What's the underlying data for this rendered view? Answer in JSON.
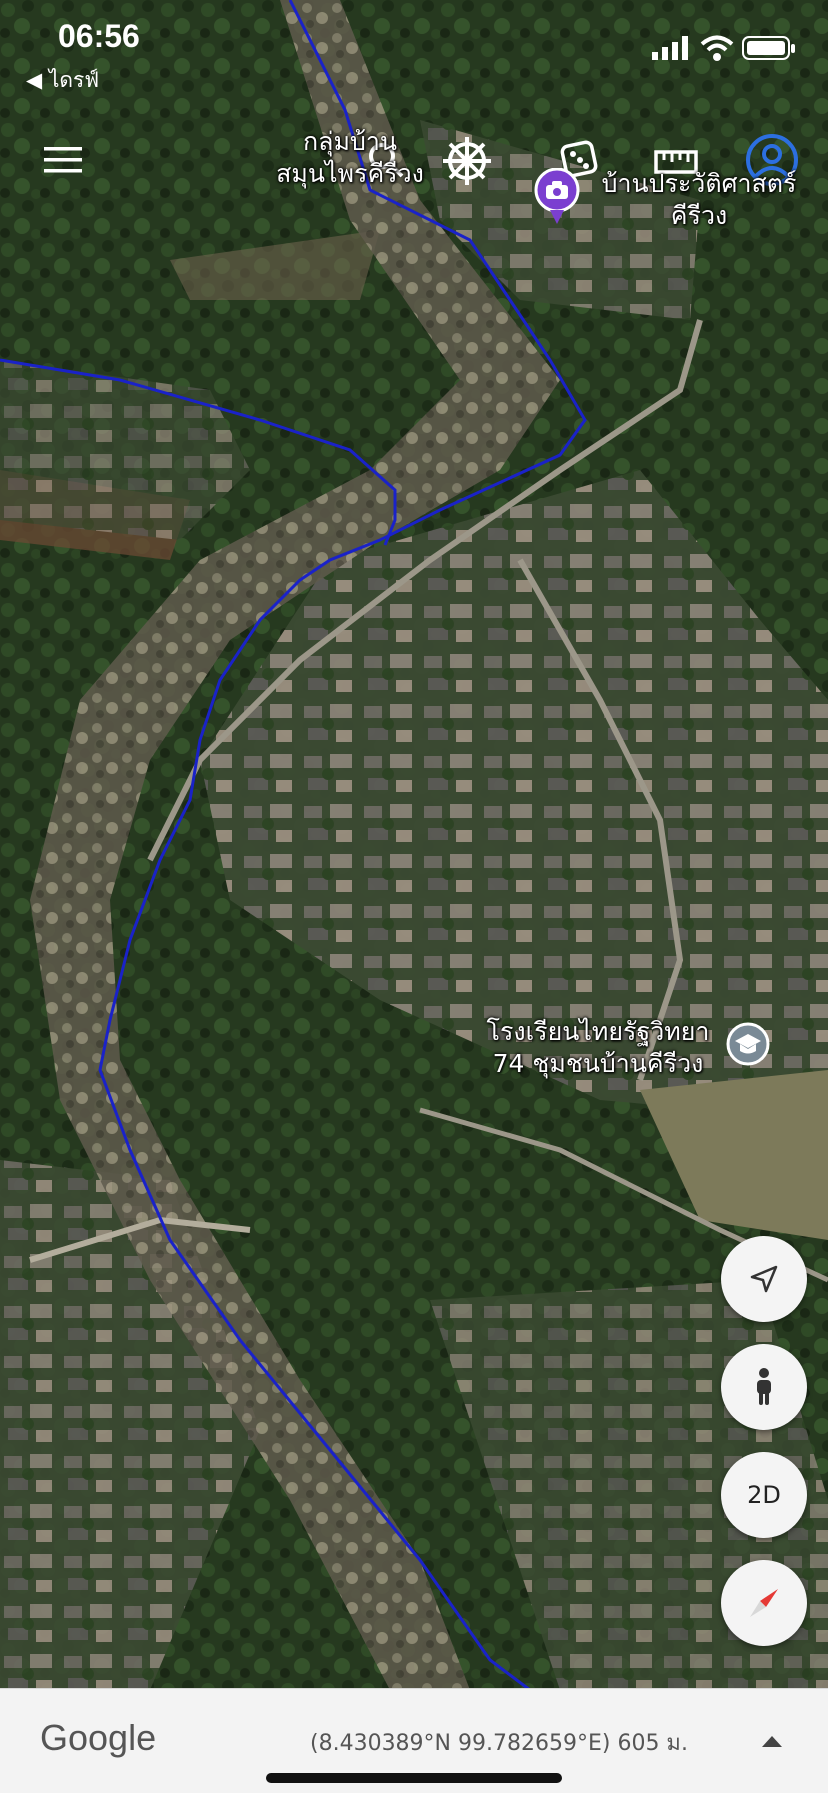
{
  "status_bar": {
    "time": "06:56",
    "back_label": "◀ ไดรฟ์"
  },
  "places": {
    "herb_group": {
      "line1": "กลุ่มบ้าน",
      "line2": "สมุนไพรคีรีวง"
    },
    "museum": {
      "line1": "บ้านประวัติศาสตร์",
      "line2": "คีรีวง"
    },
    "school": {
      "line1": "โรงเรียนไทยรัฐวิทยา",
      "line2": "74 ชุมชนบ้านคีรีวง"
    }
  },
  "controls": {
    "menu_icon": "menu-icon",
    "search_icon": "search-icon",
    "voyager_icon": "ship-wheel-icon",
    "feeling_lucky_icon": "dice-icon",
    "measure_icon": "ruler-icon",
    "account_icon": "account-icon",
    "locate_icon": "location-arrow-icon",
    "street_view_icon": "pegman-icon",
    "view_toggle_label": "2D",
    "compass_icon": "compass-icon"
  },
  "footer": {
    "brand": "Google",
    "coordinates": "(8.430389°N 99.782659°E) 605 ม.",
    "expand_icon": "caret-up-icon"
  },
  "colors": {
    "route_line": "#1a22c8",
    "compass_needle": "#e53935",
    "place_icon_purple": "#7b3fd0"
  }
}
